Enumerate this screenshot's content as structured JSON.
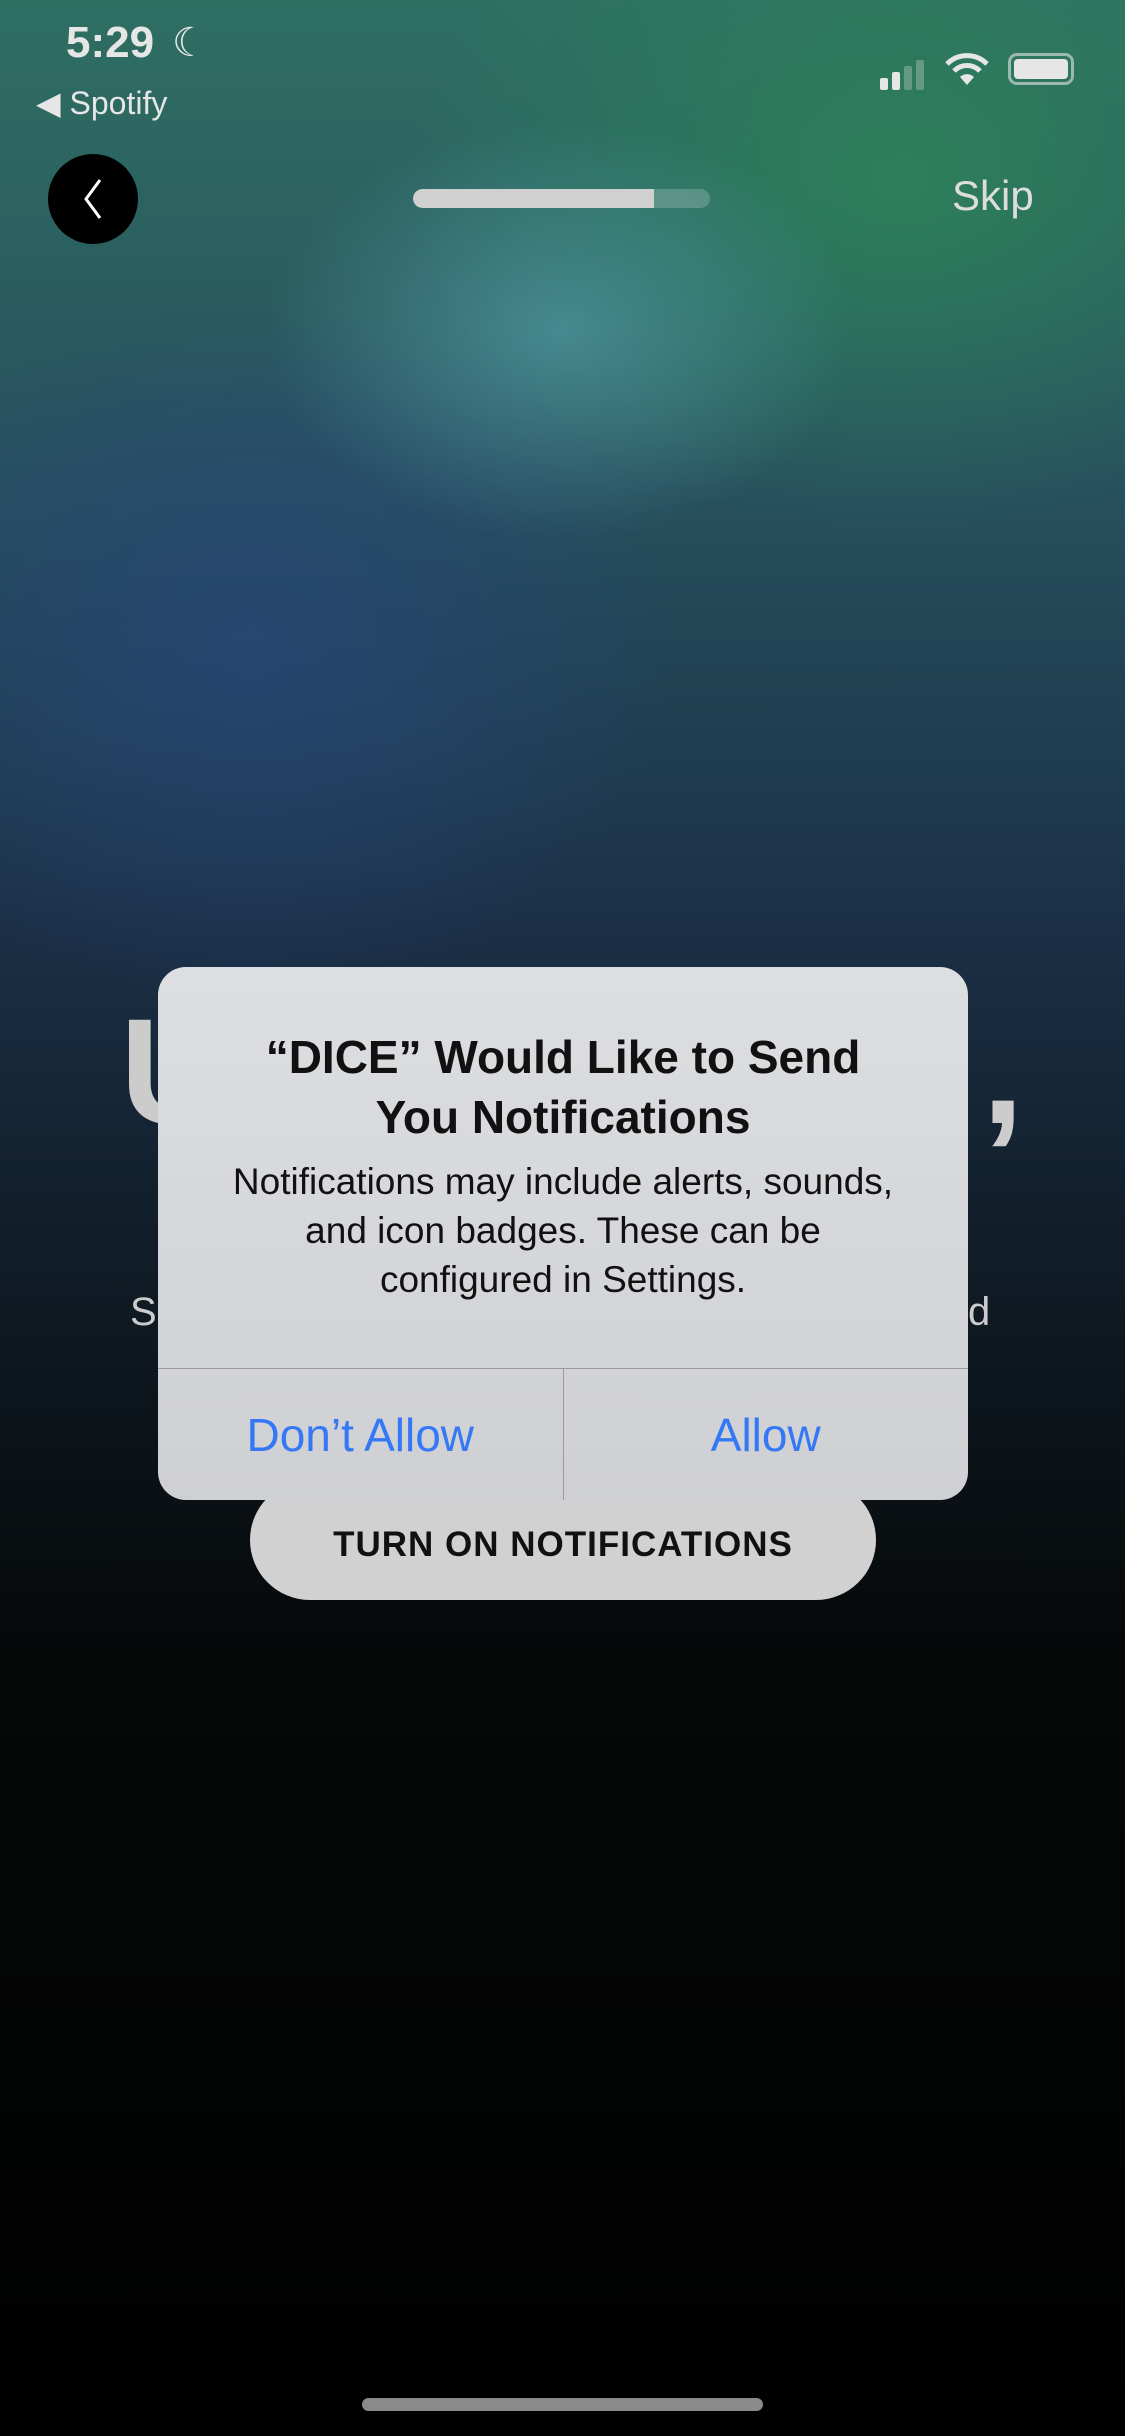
{
  "status_bar": {
    "time": "5:29",
    "focus_icon": "moon-icon",
    "back_app": "◀ Spotify",
    "signal_bars": 2,
    "battery_level": 0.9
  },
  "header": {
    "progress": 0.81,
    "skip_label": "Skip"
  },
  "onboarding": {
    "heading_partial_left": "U",
    "heading_partial_right": ",",
    "subtext_partial_left": "S",
    "subtext_partial_right": "d",
    "cta_label": "TURN ON NOTIFICATIONS"
  },
  "alert": {
    "title": "“DICE” Would Like to Send You Notifications",
    "message": "Notifications may include alerts, sounds, and icon badges. These can be configured in Settings.",
    "deny_label": "Don’t Allow",
    "allow_label": "Allow",
    "button_color": "#3478f6"
  }
}
